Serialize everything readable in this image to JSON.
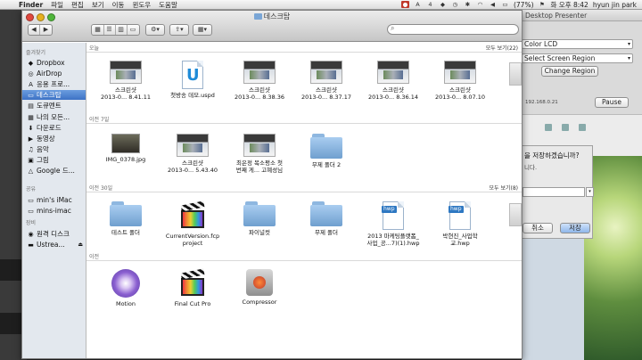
{
  "menubar": {
    "app_name": "Finder",
    "items": [
      "파일",
      "편집",
      "보기",
      "이동",
      "윈도우",
      "도움말"
    ],
    "battery": "(77%)",
    "clock": "화 오후 8:42",
    "user": "hyun jin park",
    "status_a": "A",
    "status_4": "4"
  },
  "window": {
    "title": "데스크탑",
    "search_placeholder": ""
  },
  "sidebar": {
    "favorites_header": "즐겨찾기",
    "favorites": [
      {
        "label": "Dropbox",
        "icon": "dropbox-icon"
      },
      {
        "label": "AirDrop",
        "icon": "airdrop-icon"
      },
      {
        "label": "응용 프로...",
        "icon": "applications-icon"
      },
      {
        "label": "데스크탑",
        "icon": "desktop-icon"
      },
      {
        "label": "도큐멘트",
        "icon": "documents-icon"
      },
      {
        "label": "나의 모든...",
        "icon": "all-files-icon"
      },
      {
        "label": "다운로드",
        "icon": "downloads-icon"
      },
      {
        "label": "동영상",
        "icon": "movies-icon"
      },
      {
        "label": "음악",
        "icon": "music-icon"
      },
      {
        "label": "그림",
        "icon": "pictures-icon"
      },
      {
        "label": "Google 드...",
        "icon": "google-drive-icon"
      }
    ],
    "shared_header": "공유",
    "shared": [
      {
        "label": "min's iMac",
        "icon": "imac-icon"
      },
      {
        "label": "mins-imac",
        "icon": "imac-icon"
      }
    ],
    "devices_header": "장비",
    "devices": [
      {
        "label": "원격 디스크",
        "icon": "remote-disc-icon"
      },
      {
        "label": "Ustrea...",
        "icon": "disk-icon"
      }
    ]
  },
  "sections": [
    {
      "header": "오늘",
      "more": "모두 보기(22)",
      "items": [
        {
          "label1": "스크린샷",
          "label2": "2013-0... 8.41.11",
          "kind": "thumb"
        },
        {
          "label1": "첫방송 데모.uspd",
          "label2": "",
          "kind": "doc-u"
        },
        {
          "label1": "스크린샷",
          "label2": "2013-0... 8.38.36",
          "kind": "thumb"
        },
        {
          "label1": "스크린샷",
          "label2": "2013-0... 8.37.17",
          "kind": "thumb"
        },
        {
          "label1": "스크린샷",
          "label2": "2013-0... 8.36.14",
          "kind": "thumb"
        },
        {
          "label1": "스크린샷",
          "label2": "2013-0... 8.07.10",
          "kind": "thumb"
        }
      ]
    },
    {
      "header": "이전 7일",
      "more": "",
      "items": [
        {
          "label1": "IMG_0378.jpg",
          "label2": "",
          "kind": "photo"
        },
        {
          "label1": "스크린샷",
          "label2": "2013-0... 5.43.40",
          "kind": "thumb"
        },
        {
          "label1": "최은정 목소평소 첫",
          "label2": "번째 게... 고혜성님",
          "kind": "thumb"
        },
        {
          "label1": "무제 폴더 2",
          "label2": "",
          "kind": "folder"
        }
      ]
    },
    {
      "header": "이전 30일",
      "more": "모두 보기(8)",
      "items": [
        {
          "label1": "테스트 폴더",
          "label2": "",
          "kind": "folder"
        },
        {
          "label1": "CurrentVersion.fcp",
          "label2": "project",
          "kind": "fcp"
        },
        {
          "label1": "파이널컷",
          "label2": "",
          "kind": "folder"
        },
        {
          "label1": "무제 폴더",
          "label2": "",
          "kind": "folder"
        },
        {
          "label1": "2013 마케팅플랫폼_",
          "label2": "사업_공...7)(1).hwp",
          "kind": "doc-hwp"
        },
        {
          "label1": "박현진_사업학",
          "label2": "교.hwp",
          "kind": "doc-hwp"
        }
      ]
    },
    {
      "header": "이전",
      "more": "",
      "items": [
        {
          "label1": "Motion",
          "label2": "",
          "kind": "motion"
        },
        {
          "label1": "Final Cut Pro",
          "label2": "",
          "kind": "fcp"
        },
        {
          "label1": "Compressor",
          "label2": "",
          "kind": "compressor"
        }
      ]
    }
  ],
  "background_app": {
    "title": "Desktop Presenter",
    "select1": "Color LCD",
    "select2": "Select Screen Region",
    "change_region": "Change Region",
    "ip": "192.168.0.21",
    "pause": "Pause",
    "dialog_question": "을 저장하겠습니까?",
    "dialog_sub": "니다.",
    "cancel": "취소",
    "save": "저장"
  },
  "colors": {
    "sidebar_selected": "#3d72c5",
    "folder": "#8eb7e0"
  }
}
